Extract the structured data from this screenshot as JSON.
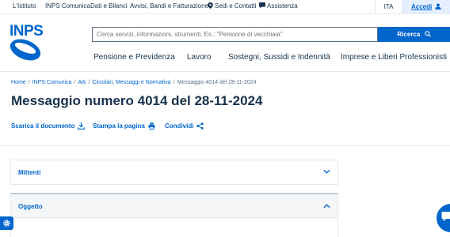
{
  "topbar": {
    "links": [
      "L'Istituto",
      "INPS Comunica",
      "Dati e Bilanci",
      "Avvisi, Bandi e Fatturazione",
      "Sedi e Contatti",
      "Assistenza"
    ],
    "lang": "ITA",
    "login": "Accedi"
  },
  "logo": {
    "text": "INPS"
  },
  "search": {
    "placeholder": "Cerca servizi, informazioni, strumenti. Es.: \"Pensione di vecchiaia\"",
    "button": "Ricerca"
  },
  "nav": [
    "Pensione e Previdenza",
    "Lavoro",
    "Sostegni, Sussidi e Indennità",
    "Imprese e Liberi Professionisti"
  ],
  "breadcrumb": {
    "items": [
      "Home",
      "INPS Comunica",
      "Atti",
      "Circolari, Messaggi e Normativa"
    ],
    "current": "Messaggio 4014 del 28-11-2024"
  },
  "page": {
    "title": "Messaggio numero 4014 del 28-11-2024"
  },
  "actions": {
    "download": "Scarica il documento",
    "print": "Stampa la pagina",
    "share": "Condividi"
  },
  "accordions": [
    {
      "label": "Mittenti",
      "state": "collapsed"
    },
    {
      "label": "Oggetto",
      "state": "expanded"
    }
  ],
  "colors": {
    "primary": "#0066cc",
    "text": "#17324d",
    "login_bg": "#e5efff"
  }
}
